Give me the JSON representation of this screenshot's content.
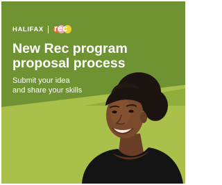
{
  "brand": {
    "halifax": "HALIFAX",
    "rec_logo_text": "rec",
    "logo_colors": [
      "#ef6a3a",
      "#f2a0b6",
      "#e8d530"
    ]
  },
  "headline": {
    "line1": "New Rec program",
    "line2": "proposal process"
  },
  "subline": {
    "line1": "Submit your idea",
    "line2": "and share your skills"
  },
  "colors": {
    "background_light_green": "#a9c04a",
    "background_dark_green": "#6f9232",
    "text": "#ffffff"
  }
}
